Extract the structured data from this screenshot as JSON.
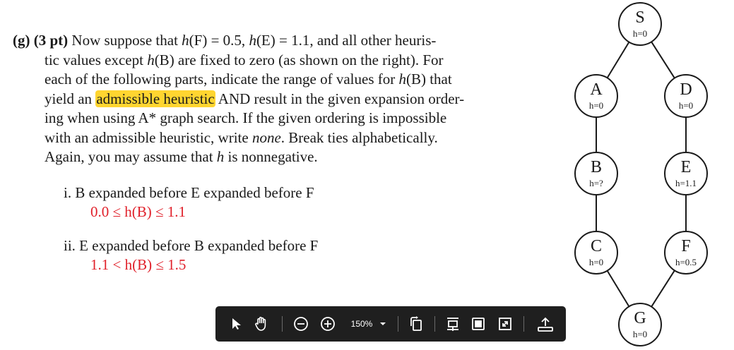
{
  "question": {
    "lines": [
      {
        "segments": [
          {
            "t": "(g)  ",
            "cls": "bold"
          },
          {
            "t": "(3 pt)",
            "cls": "bold"
          },
          {
            "t": " Now suppose that ",
            "cls": ""
          },
          {
            "t": "h",
            "cls": "it"
          },
          {
            "t": "(F) = 0.5, ",
            "cls": ""
          },
          {
            "t": "h",
            "cls": "it"
          },
          {
            "t": "(E) = 1.1, and all other heuris-",
            "cls": ""
          }
        ]
      },
      {
        "segments": [
          {
            "t": "tic values except ",
            "cls": ""
          },
          {
            "t": "h",
            "cls": "it"
          },
          {
            "t": "(B) are fixed to zero (as shown on the right).  For",
            "cls": ""
          }
        ]
      },
      {
        "segments": [
          {
            "t": "each of the following parts, indicate the range of values for ",
            "cls": ""
          },
          {
            "t": "h",
            "cls": "it"
          },
          {
            "t": "(B) that",
            "cls": ""
          }
        ]
      },
      {
        "segments": [
          {
            "t": "yield an ",
            "cls": ""
          },
          {
            "t": "admissible heuristic",
            "cls": "hl"
          },
          {
            "t": " AND result in the given expansion order-",
            "cls": ""
          }
        ]
      },
      {
        "segments": [
          {
            "t": "ing when using A* graph search.  If the given ordering is impossible",
            "cls": ""
          }
        ]
      },
      {
        "segments": [
          {
            "t": "with an admissible heuristic, write ",
            "cls": ""
          },
          {
            "t": "none",
            "cls": "it"
          },
          {
            "t": ".  Break ties alphabetically.",
            "cls": ""
          }
        ]
      },
      {
        "segments": [
          {
            "t": "Again, you may assume that ",
            "cls": ""
          },
          {
            "t": "h",
            "cls": "it"
          },
          {
            "t": " is nonnegative.",
            "cls": ""
          }
        ]
      }
    ]
  },
  "parts": [
    {
      "prompt": "i.  B expanded before E expanded before F",
      "answer": "0.0 ≤ h(B) ≤ 1.1"
    },
    {
      "prompt": "ii.  E expanded before B expanded before F",
      "answer": "1.1 < h(B) ≤ 1.5"
    }
  ],
  "graph": {
    "nodes": [
      {
        "id": "S",
        "h": "h=0"
      },
      {
        "id": "A",
        "h": "h=0"
      },
      {
        "id": "D",
        "h": "h=0"
      },
      {
        "id": "B",
        "h": "h=?"
      },
      {
        "id": "E",
        "h": "h=1.1"
      },
      {
        "id": "C",
        "h": "h=0"
      },
      {
        "id": "F",
        "h": "h=0.5"
      },
      {
        "id": "G",
        "h": "h=0"
      }
    ],
    "edges": [
      [
        "S",
        "A"
      ],
      [
        "S",
        "D"
      ],
      [
        "A",
        "B"
      ],
      [
        "D",
        "E"
      ],
      [
        "B",
        "C"
      ],
      [
        "E",
        "F"
      ],
      [
        "C",
        "G"
      ],
      [
        "F",
        "G"
      ]
    ]
  },
  "toolbar": {
    "zoom_level": "150%",
    "icons": [
      "select-pointer-icon",
      "hand-pan-icon",
      "zoom-out-icon",
      "zoom-in-icon",
      "zoom-dropdown-icon",
      "rotate-page-icon",
      "fit-width-icon",
      "page-view-icon",
      "fullscreen-icon",
      "share-upload-icon"
    ]
  }
}
